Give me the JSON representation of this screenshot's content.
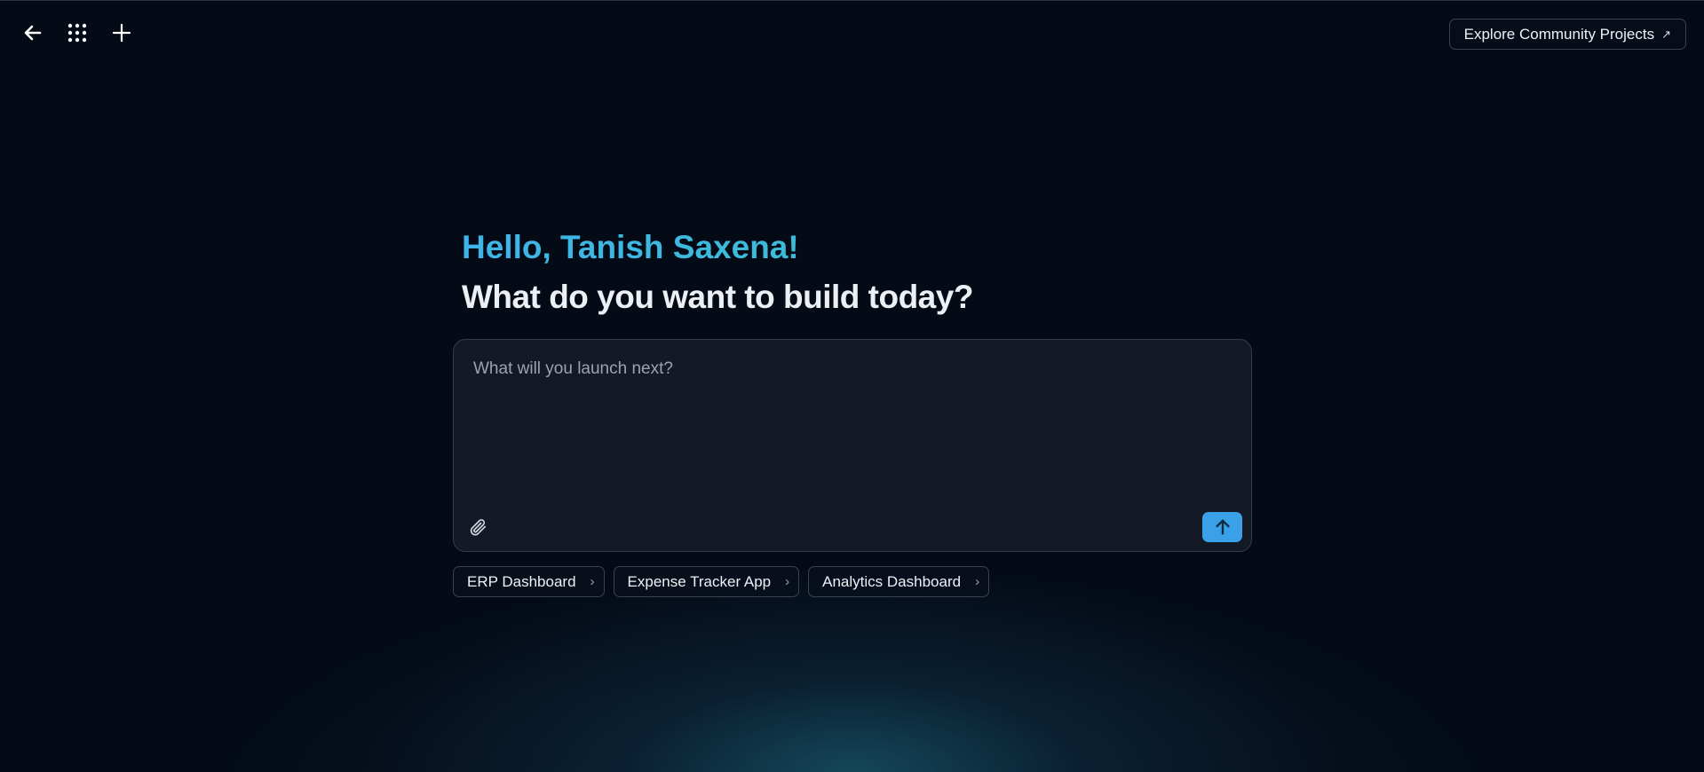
{
  "topbar": {
    "back_icon": "arrow-left-icon",
    "apps_icon": "grid-dots-icon",
    "new_icon": "plus-icon",
    "explore_label": "Explore Community Projects",
    "explore_icon": "external-arrow-icon"
  },
  "hero": {
    "greeting": "Hello, Tanish Saxena!",
    "subtitle": "What do you want to build today?"
  },
  "prompt": {
    "placeholder": "What will you launch next?",
    "value": "",
    "attach_icon": "paperclip-icon",
    "send_icon": "arrow-up-icon"
  },
  "suggestions": [
    {
      "label": "ERP Dashboard"
    },
    {
      "label": "Expense Tracker App"
    },
    {
      "label": "Analytics Dashboard"
    }
  ],
  "colors": {
    "background": "#040a16",
    "accent": "#3aa0e8",
    "greeting_gradient_start": "#3fb4ea",
    "greeting_gradient_end": "#3bbfcf"
  }
}
